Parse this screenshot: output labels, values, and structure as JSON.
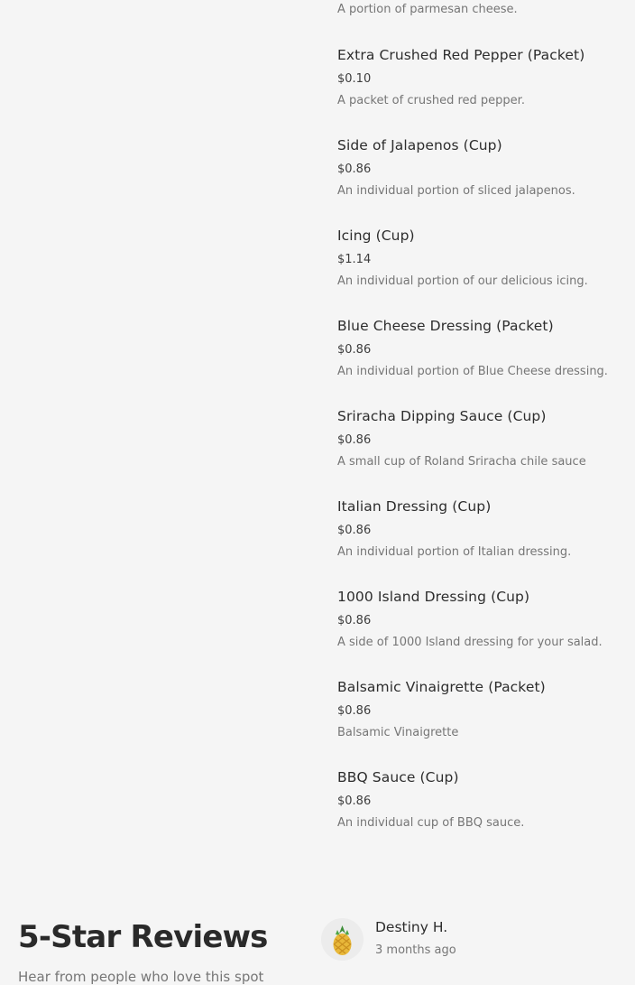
{
  "menu": {
    "first_item_description": "A portion of parmesan cheese.",
    "items": [
      {
        "name": "Extra Crushed Red Pepper (Packet)",
        "price": "$0.10",
        "description": "A packet of crushed red pepper."
      },
      {
        "name": "Side of Jalapenos (Cup)",
        "price": "$0.86",
        "description": "An individual portion of sliced jalapenos."
      },
      {
        "name": "Icing (Cup)",
        "price": "$1.14",
        "description": "An individual portion of our delicious icing."
      },
      {
        "name": "Blue Cheese Dressing (Packet)",
        "price": "$0.86",
        "description": "An individual portion of Blue Cheese dressing."
      },
      {
        "name": "Sriracha Dipping Sauce (Cup)",
        "price": "$0.86",
        "description": "A small cup of Roland Sriracha chile sauce"
      },
      {
        "name": "Italian Dressing (Cup)",
        "price": "$0.86",
        "description": "An individual portion of Italian dressing."
      },
      {
        "name": "1000 Island Dressing (Cup)",
        "price": "$0.86",
        "description": "A side of 1000 Island dressing for your salad."
      },
      {
        "name": "Balsamic Vinaigrette (Packet)",
        "price": "$0.86",
        "description": "Balsamic Vinaigrette"
      },
      {
        "name": "BBQ Sauce (Cup)",
        "price": "$0.86",
        "description": "An individual cup of BBQ sauce."
      }
    ]
  },
  "reviews": {
    "title": "5-Star Reviews",
    "subtitle": "Hear from people who love this spot",
    "review": {
      "reviewer_name": "Destiny H.",
      "time_ago": "3 months ago",
      "avatar_icon": "pineapple-icon"
    }
  }
}
